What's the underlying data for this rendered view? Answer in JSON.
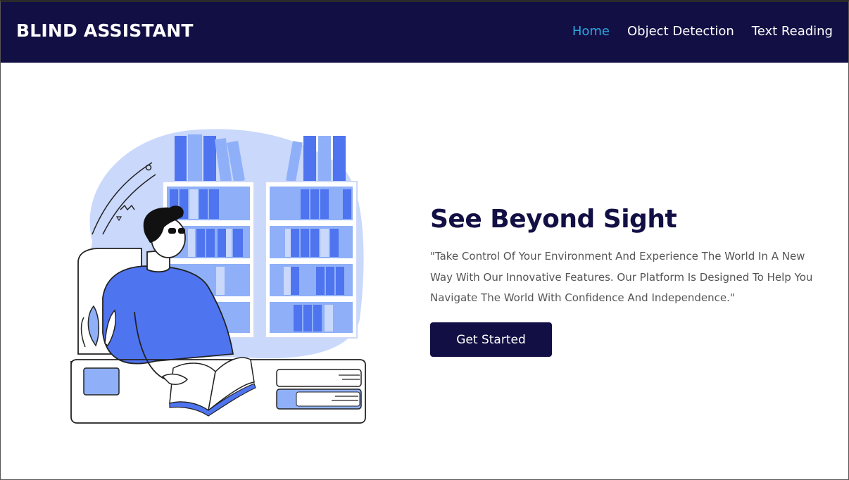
{
  "navbar": {
    "brand": "BLIND ASSISTANT",
    "links": [
      {
        "label": "Home",
        "active": true
      },
      {
        "label": "Object Detection",
        "active": false
      },
      {
        "label": "Text Reading",
        "active": false
      }
    ]
  },
  "hero": {
    "title": "See Beyond Sight",
    "description": "\"Take Control Of Your Environment And Experience The World In A New Way With Our Innovative Features. Our Platform Is Designed To Help You Navigate The World With Confidence And Independence.\"",
    "cta_label": "Get Started",
    "illustration": "person-reading-library-illustration"
  },
  "colors": {
    "nav_bg": "#120f44",
    "nav_active": "#2aa7e0",
    "accent_blue": "#4f74f0",
    "light_blue": "#c9d8fb"
  }
}
